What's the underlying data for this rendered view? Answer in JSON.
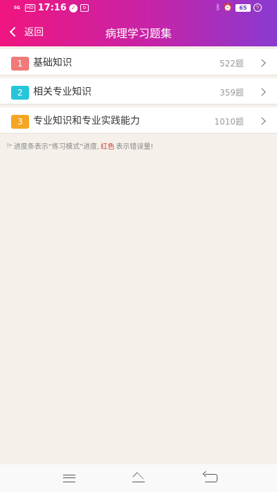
{
  "status_bar": {
    "signal": "5G",
    "hd": "HD",
    "time": "17:16",
    "battery": "65",
    "icons": [
      "signal-icon",
      "hd-icon",
      "app-notification-icon",
      "app2-icon",
      "bluetooth-icon",
      "alarm-icon",
      "battery-icon",
      "charging-icon"
    ]
  },
  "header": {
    "back_label": "返回",
    "title": "病理学习题集",
    "gradient_colors": [
      "#f0157f",
      "#c624a8",
      "#8a3ad0"
    ]
  },
  "categories": [
    {
      "index": "1",
      "title": "基础知识",
      "count": "522题",
      "badge_color": "#f07a7a"
    },
    {
      "index": "2",
      "title": "相关专业知识",
      "count": "359题",
      "badge_color": "#26c6da"
    },
    {
      "index": "3",
      "title": "专业知识和专业实践能力",
      "count": "1010题",
      "badge_color": "#f5a623"
    }
  ],
  "hint": {
    "text_before": "进度条表示“练习模式”进度,",
    "text_red": "红色",
    "text_after": "表示错误量!",
    "red_color": "#d0392b"
  },
  "system_nav": {
    "icons": [
      "menu-icon",
      "home-icon",
      "back-icon"
    ]
  },
  "colors": {
    "background": "#f5f1ea"
  }
}
